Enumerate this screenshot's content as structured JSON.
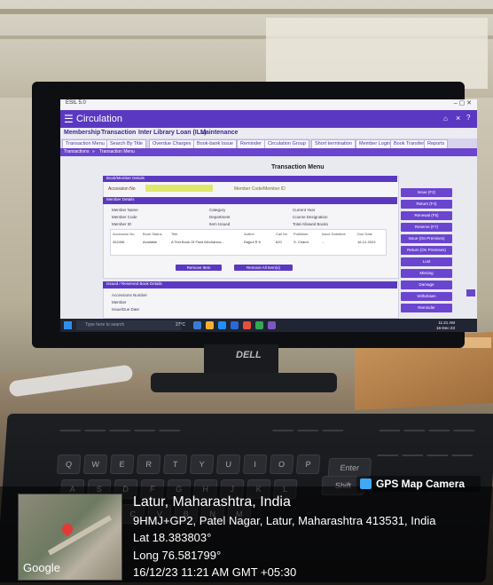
{
  "screen": {
    "app_title": "ESIL 5.0",
    "header_title": "Circulation",
    "menu": [
      "Membership",
      "Transaction",
      "Inter Library Loan (ILL)",
      "Maintenance"
    ],
    "subtabs": [
      "Transaction Menu",
      "Search By Title",
      "Overdue Charges",
      "Book-bank Issue",
      "Reminder",
      "Circulation Group",
      "Short termination",
      "Member Login",
      "Book Transfer",
      "Reports"
    ],
    "breadcrumb": [
      "Transactions",
      "Transaction Menu"
    ],
    "page_heading": "Transaction Menu",
    "book_section": {
      "title": "Book/Member Details",
      "accession_label": "Accession No",
      "member_label": "Member Code/Member ID"
    },
    "member_section": {
      "title": "Member Details",
      "fields_left": [
        "Member Name",
        "Member Code",
        "Member ID"
      ],
      "fields_mid": [
        "Category",
        "Department",
        "Item Issued"
      ],
      "fields_right": [
        "Current Year",
        "Course Designation",
        "Total Allowed Books"
      ],
      "grid_headers": [
        "Accession No",
        "Book Status",
        "Title",
        "Author",
        "Call No",
        "Publisher",
        "Issue Datetime",
        "Due Date"
      ],
      "grid_row": [
        "452496",
        "Available",
        "A Text Book Of Fluid Mechanics...",
        "Rajput R K",
        "620",
        "S. Chand",
        "...",
        "16-12-2023"
      ],
      "remove_label": "Remove Item",
      "remove_all_label": "Remove All Item(s)"
    },
    "issued_section": {
      "title": "Issued / Reserved Book Details",
      "fields": [
        "Accessions Number",
        "Member",
        "Issue/Due Date"
      ]
    },
    "side_buttons": [
      "Issue (F2)",
      "Return (F4)",
      "Renewal (F5)",
      "Reserve (F7)",
      "Issue (On Premises)",
      "Return (On Premises)",
      "Lost",
      "Missing",
      "Damage",
      "Withdrawn",
      "Reminder"
    ],
    "taskbar": {
      "search_placeholder": "Type here to search",
      "temperature": "27°C",
      "clock_time": "11:21 AM",
      "clock_date": "16-Dec-23"
    }
  },
  "monitor_brand": "DELL",
  "keyboard_keys": [
    "Q",
    "W",
    "E",
    "R",
    "T",
    "Y",
    "U",
    "I",
    "O",
    "P",
    "A",
    "S",
    "D",
    "F",
    "G",
    "H",
    "J",
    "K",
    "L",
    "Z",
    "X",
    "C",
    "V",
    "B",
    "N",
    "M",
    "Enter",
    "Shift"
  ],
  "gps": {
    "badge": "GPS Map Camera",
    "city": "Latur, Maharashtra, India",
    "address": "9HMJ+GP2, Patel Nagar, Latur, Maharashtra 413531, India",
    "lat": "Lat 18.383803°",
    "long": "Long 76.581799°",
    "datetime": "16/12/23 11:21 AM GMT +05:30",
    "map_brand": "Google"
  },
  "colors": {
    "app_purple": "#5b38c2",
    "accession_highlight": "#dfe86d",
    "gps_badge_icon": "#3fa9f5"
  }
}
